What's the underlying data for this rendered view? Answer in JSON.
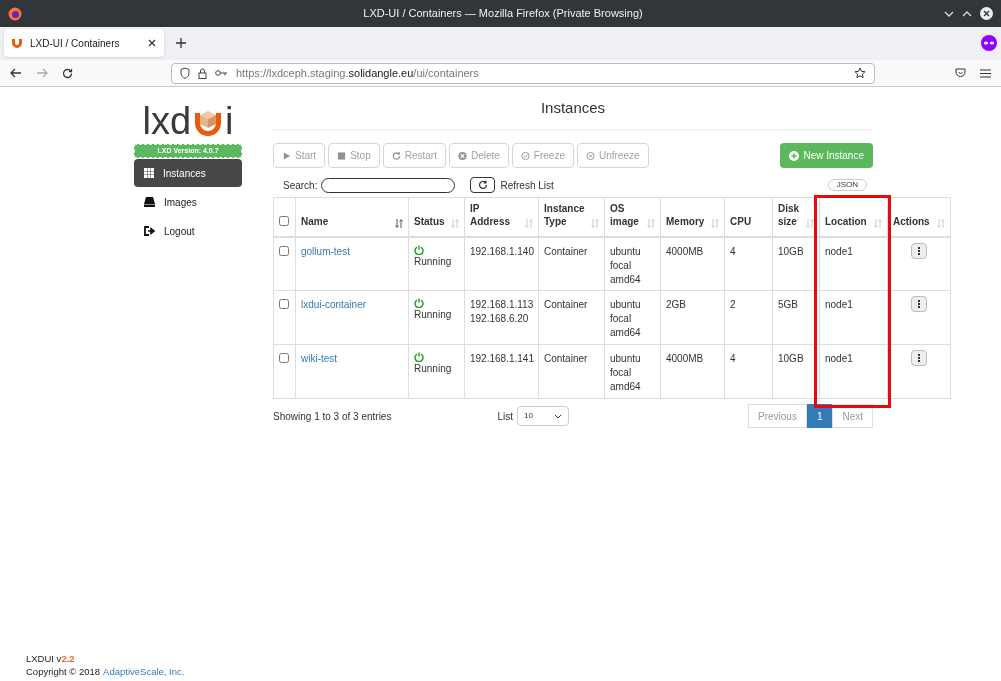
{
  "window": {
    "title": "LXD-UI / Containers — Mozilla Firefox (Private Browsing)"
  },
  "tabs": [
    {
      "label": "LXD-UI / Containers",
      "selected": true
    }
  ],
  "address_bar": {
    "url": "https://lxdceph.staging.**solidangle.eu**/ui/containers"
  },
  "logo": {
    "left": "lxd",
    "right": "i",
    "version": "LXD Version: 4.0.7"
  },
  "sidebar": {
    "items": [
      {
        "label": "Instances",
        "selected": true
      },
      {
        "label": "Images",
        "selected": false
      },
      {
        "label": "Logout",
        "selected": false
      }
    ]
  },
  "page_title": "Instances",
  "toolbar": [
    {
      "label": "Start",
      "disabled": true
    },
    {
      "label": "Stop",
      "disabled": true
    },
    {
      "label": "Restart",
      "disabled": true
    },
    {
      "label": "Delete",
      "disabled": true
    },
    {
      "label": "Freeze",
      "disabled": true
    },
    {
      "label": "Unfreeze",
      "disabled": true
    }
  ],
  "new_instance_button": "New Instance",
  "search": {
    "label": "Search:"
  },
  "refresh_label": "Refresh List",
  "json_button": "JSON",
  "table": {
    "columns": [
      {
        "kind": "checkbox",
        "checked": false
      },
      {
        "label": "Name",
        "sorted": true,
        "highlighted": false
      },
      {
        "label": "Status",
        "sorted": false,
        "highlighted": false
      },
      {
        "label": "IP Address",
        "sorted": false,
        "highlighted": false
      },
      {
        "label": "Instance Type",
        "sorted": false,
        "highlighted": false
      },
      {
        "label": "OS image",
        "sorted": false,
        "highlighted": false
      },
      {
        "label": "Memory",
        "sorted": false,
        "highlighted": false
      },
      {
        "label": "CPU",
        "highlighted": false
      },
      {
        "label": "Disk size",
        "sorted": false,
        "highlighted": false
      },
      {
        "label": "Location",
        "sorted": false,
        "highlighted": true
      },
      {
        "label": "Actions",
        "sorted": false,
        "highlighted": false
      }
    ],
    "rows": [
      {
        "checked": false,
        "name": "gollum-test",
        "status": "Running",
        "ip": [
          "192.168.1.140"
        ],
        "type": "Container",
        "os": [
          "ubuntu",
          "focal",
          "amd64"
        ],
        "memory": "4000MB",
        "cpu": "4",
        "disk": "10GB",
        "location": "node1"
      },
      {
        "checked": false,
        "name": "lxdui-container",
        "status": "Running",
        "ip": [
          "192.168.1.113",
          "192.168.6.20"
        ],
        "type": "Container",
        "os": [
          "ubuntu",
          "focal",
          "amd64"
        ],
        "memory": "2GB",
        "cpu": "2",
        "disk": "5GB",
        "location": "node1"
      },
      {
        "checked": false,
        "name": "wiki-test",
        "status": "Running",
        "ip": [
          "192.168.1.141"
        ],
        "type": "Container",
        "os": [
          "ubuntu",
          "focal",
          "amd64"
        ],
        "memory": "4000MB",
        "cpu": "4",
        "disk": "10GB",
        "location": "node1"
      }
    ]
  },
  "footer_info": "Showing 1 to 3 of 3 entries",
  "page_size": {
    "label": "List",
    "value": "10"
  },
  "pagination": [
    {
      "label": "Previous",
      "selected": false
    },
    {
      "label": "1",
      "selected": true
    },
    {
      "label": "Next",
      "selected": false
    }
  ],
  "app_footer": {
    "name": "LXDUI v",
    "version": "2.2",
    "copyright": "Copyright © 2018",
    "link": "AdaptiveScale, Inc."
  }
}
